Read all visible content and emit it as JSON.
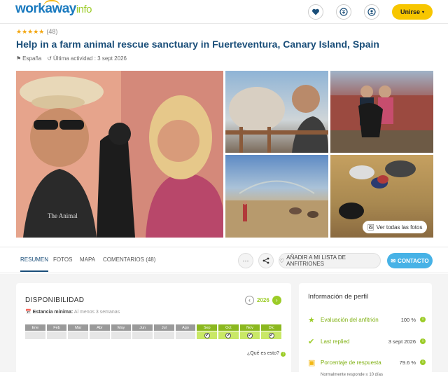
{
  "header": {
    "logo_main": "workaway",
    "logo_suffix": "info",
    "join_label": "Unirse",
    "icons": [
      "heart-icon",
      "currency-icon",
      "user-icon"
    ],
    "accent_color": "#f7c600"
  },
  "listing": {
    "rating_stars": 5,
    "rating_count": "(48)",
    "title": "Help in a farm animal rescue sanctuary in Fuerteventura, Canary Island, Spain",
    "country": "España",
    "last_activity": "Última actividad : 3 sept 2026",
    "view_all_photos": "Ver todas las fotos"
  },
  "tabs": {
    "items": [
      {
        "label": "RESUMEN",
        "active": true
      },
      {
        "label": "FOTOS",
        "active": false
      },
      {
        "label": "MAPA",
        "active": false
      },
      {
        "label": "COMENTARIOS (48)",
        "active": false
      }
    ],
    "more_label": "···",
    "add_to_list": "AÑADIR A MI LISTA DE ANFITRIONES",
    "contact": "CONTACTO",
    "contact_color": "#47b2e6"
  },
  "availability": {
    "title": "DISPONIBILIDAD",
    "year": "2026",
    "min_stay_label": "Estancia mínima:",
    "min_stay_value": "Al menos 3 semanas",
    "months": [
      {
        "name": "Ene",
        "available": false
      },
      {
        "name": "Feb",
        "available": false
      },
      {
        "name": "Mar",
        "available": false
      },
      {
        "name": "Abr",
        "available": false
      },
      {
        "name": "May",
        "available": false
      },
      {
        "name": "Jun",
        "available": false
      },
      {
        "name": "Jul",
        "available": false
      },
      {
        "name": "Ago",
        "available": false
      },
      {
        "name": "Sep",
        "available": true
      },
      {
        "name": "Oct",
        "available": true
      },
      {
        "name": "Nov",
        "available": true
      },
      {
        "name": "Dic",
        "available": true
      }
    ],
    "what_is_it": "¿Qué es esto?",
    "available_color": "#9ccc28"
  },
  "profile": {
    "title": "Información de perfil",
    "rows": [
      {
        "label": "Evaluación del anfitrión",
        "value": "100 %",
        "icon": "star-badge-icon"
      },
      {
        "label": "Last replied",
        "value": "3 sept 2026",
        "icon": "reply-icon"
      },
      {
        "label": "Porcentaje de respuesta",
        "value": "79.6 %",
        "icon": "response-icon"
      }
    ],
    "response_note": "Normalmente responde ≤ 10 días"
  }
}
